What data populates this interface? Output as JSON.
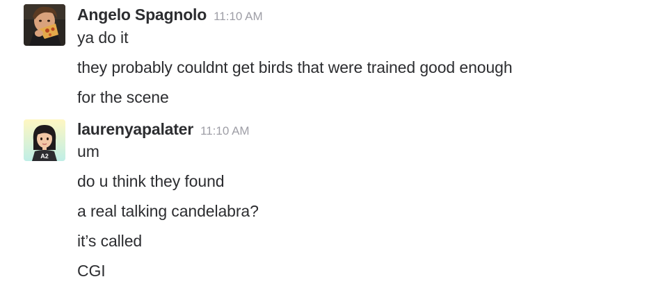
{
  "messages": [
    {
      "author": "Angelo Spagnolo",
      "time": "11:10 AM",
      "avatar": "photo-avatar-person-eating-pizza",
      "lines": [
        "ya do it",
        "they probably couldnt get birds that were trained good enough",
        "for the scene"
      ]
    },
    {
      "author": "laurenyapalater",
      "time": "11:10 AM",
      "avatar": "illustrated-avatar-dark-hair-woman-A2-shirt",
      "lines": [
        "um",
        "do u think they found",
        "a real talking candelabra?",
        "it’s called",
        "CGI"
      ]
    }
  ],
  "colors": {
    "text": "#2c2d30",
    "timestamp": "#9e9ea6",
    "background": "#ffffff"
  }
}
